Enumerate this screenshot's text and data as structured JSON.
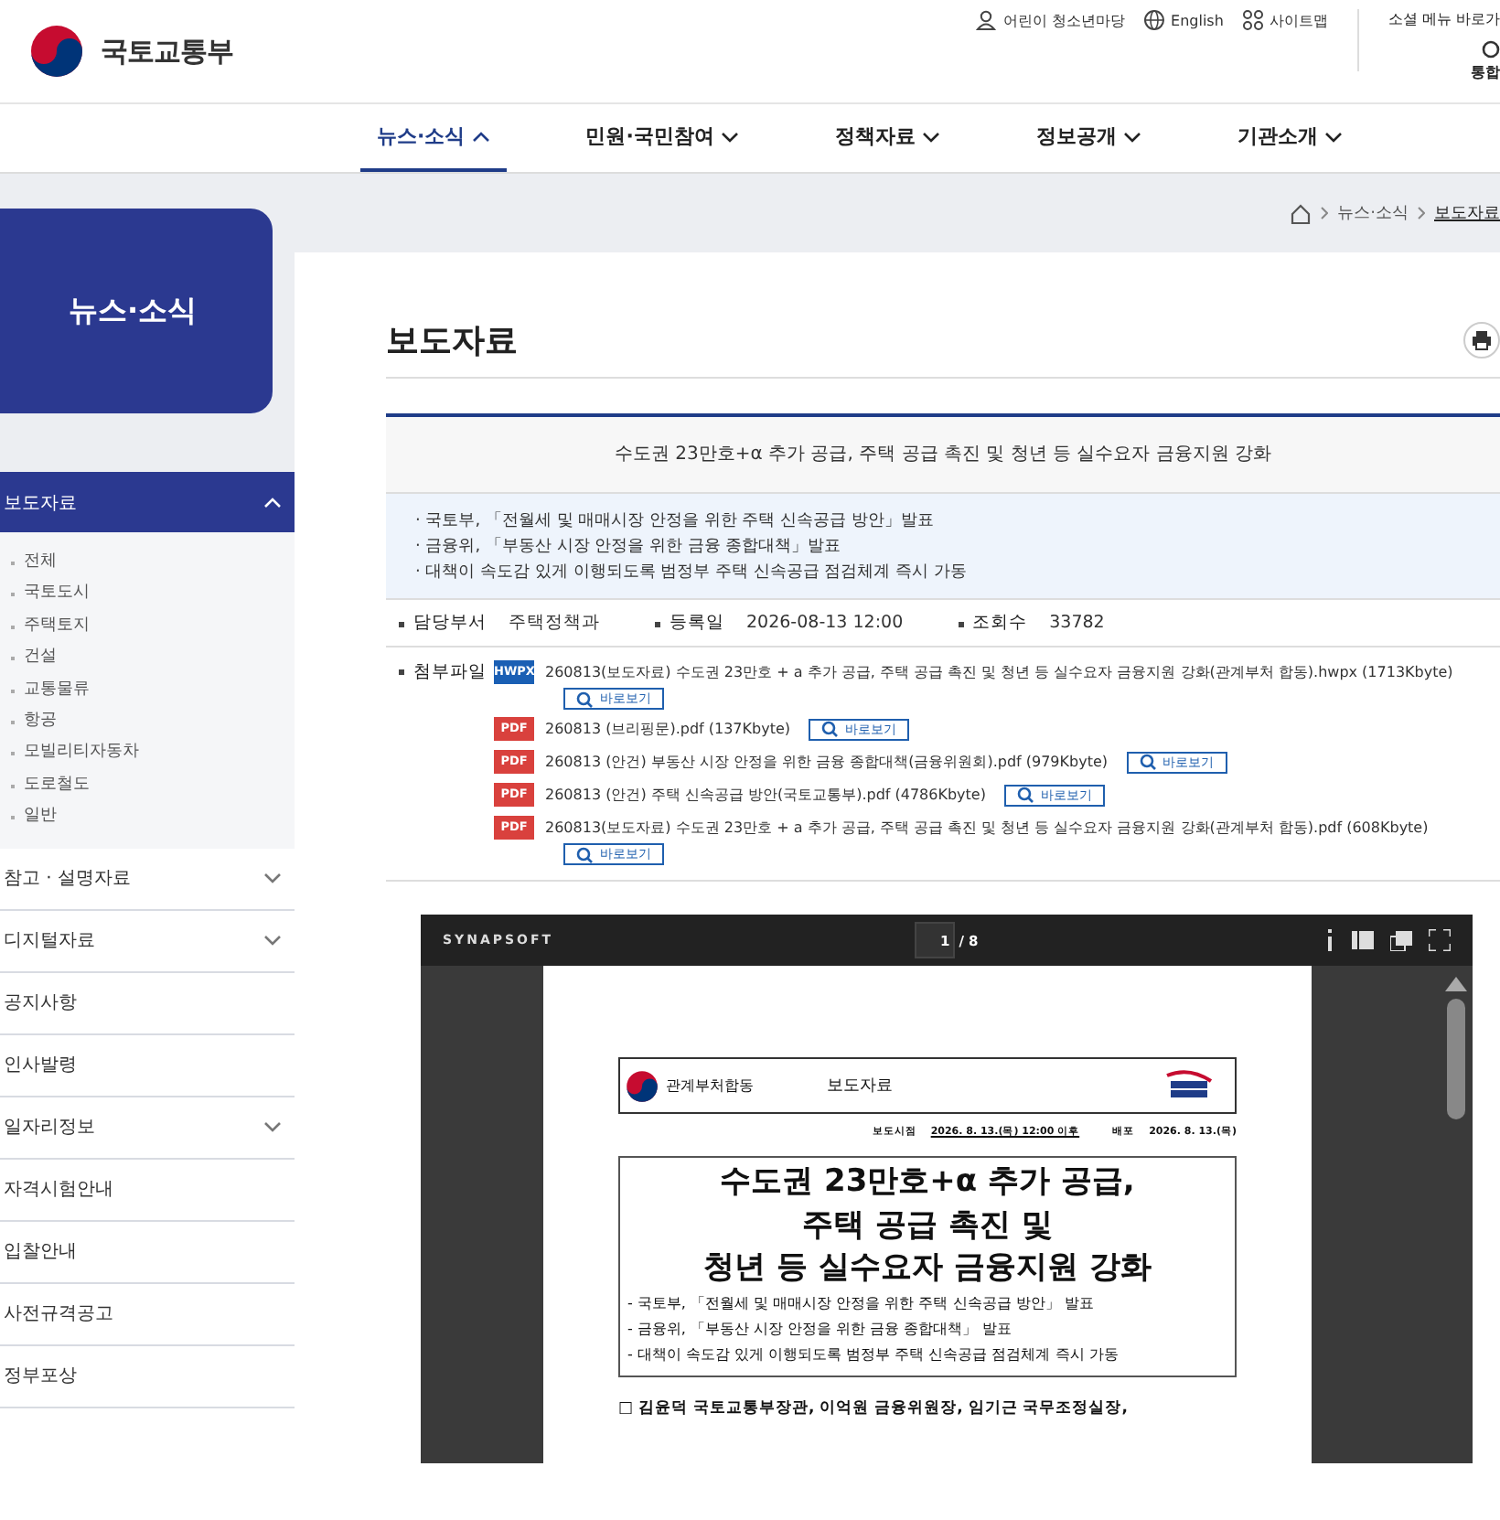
{
  "header": {
    "logo_text": "국토교통부",
    "utility_links": [
      {
        "label": "어린이 청소년마당"
      },
      {
        "label": "English"
      },
      {
        "label": "사이트맵"
      }
    ],
    "social_menu": "소셜 메뉴 바로가",
    "search_label": "통합"
  },
  "nav": [
    {
      "label": "뉴스·소식",
      "selected": true
    },
    {
      "label": "민원·국민참여",
      "selected": false
    },
    {
      "label": "정책자료",
      "selected": false
    },
    {
      "label": "정보공개",
      "selected": false
    },
    {
      "label": "기관소개",
      "selected": false
    }
  ],
  "sidebar": {
    "title": "뉴스·소식",
    "items": [
      {
        "label": "보도자료",
        "expandable": true,
        "expanded": true,
        "children": [
          {
            "label": "전체"
          },
          {
            "label": "국토도시"
          },
          {
            "label": "주택토지"
          },
          {
            "label": "건설"
          },
          {
            "label": "교통물류"
          },
          {
            "label": "항공"
          },
          {
            "label": "모빌리티자동차"
          },
          {
            "label": "도로철도"
          },
          {
            "label": "일반"
          }
        ]
      },
      {
        "label": "참고 · 설명자료",
        "expandable": true,
        "expanded": false
      },
      {
        "label": "디지털자료",
        "expandable": true,
        "expanded": false
      },
      {
        "label": "공지사항",
        "expandable": false,
        "expanded": false
      },
      {
        "label": "인사발령",
        "expandable": false,
        "expanded": false
      },
      {
        "label": "일자리정보",
        "expandable": true,
        "expanded": false
      },
      {
        "label": "자격시험안내",
        "expandable": false,
        "expanded": false
      },
      {
        "label": "입찰안내",
        "expandable": false,
        "expanded": false
      },
      {
        "label": "사전규격공고",
        "expandable": false,
        "expanded": false
      },
      {
        "label": "정부포상",
        "expandable": false,
        "expanded": false
      }
    ]
  },
  "breadcrumb": [
    "뉴스·소식",
    "보도자료"
  ],
  "page_title": "보도자료",
  "article": {
    "subject": "수도권 23만호+α 추가 공급, 주택 공급 촉진 및 청년 등 실수요자 금융지원 강화",
    "summary": [
      "· 국토부, 「전월세 및 매매시장 안정을 위한 주택 신속공급 방안」발표",
      "· 금융위, 「부동산 시장 안정을 위한 금융 종합대책」발표",
      "· 대책이 속도감 있게 이행되도록 범정부 주택 신속공급 점검체계 즉시 가동"
    ],
    "meta": [
      {
        "label": "담당부서",
        "value": "주택정책과"
      },
      {
        "label": "등록일",
        "value": "2026-08-13 12:00"
      },
      {
        "label": "조회수",
        "value": "33782"
      }
    ],
    "attachments_label": "첨부파일",
    "attachments": [
      {
        "kind": "hwpx",
        "badge": "HWPX",
        "name": "260813(보도자료) 수도권 23만호 + a 추가 공급, 주택 공급 촉진 및 청년 등 실수요자 금융지원 강화(관계부처 합동).hwpx",
        "size": "(1713Kbyte)",
        "button": "바로보기"
      },
      {
        "kind": "pdf",
        "badge": "PDF",
        "name": "260813 (브리핑문).pdf",
        "size": "(137Kbyte)",
        "button": "바로보기"
      },
      {
        "kind": "pdf",
        "badge": "PDF",
        "name": "260813 (안건) 부동산 시장 안정을 위한 금융 종합대책(금융위원회).pdf",
        "size": "(979Kbyte)",
        "button": "바로보기"
      },
      {
        "kind": "pdf",
        "badge": "PDF",
        "name": "260813 (안건) 주택 신속공급 방안(국토교통부).pdf",
        "size": "(4786Kbyte)",
        "button": "바로보기"
      },
      {
        "kind": "pdf",
        "badge": "PDF",
        "name": "260813(보도자료) 수도권 23만호 + a 추가 공급, 주택 공급 촉진 및 청년 등 실수요자 금융지원 강화(관계부처 합동).pdf",
        "size": "(608Kbyte)",
        "button": "바로보기"
      }
    ]
  },
  "viewer": {
    "brand": "SYNAPSOFT",
    "page_input": "1",
    "page_total": "/ 8",
    "document": {
      "header_left": "관계부처합동",
      "header_center": "보도자료",
      "release_label": "보도시점",
      "release_value": "2026. 8. 13.(목) 12:00 이후",
      "dist_label": "배포",
      "dist_value": "2026. 8. 13.(목)",
      "title_lines": [
        "수도권 23만호+α 추가 공급,",
        "주택 공급 촉진 및",
        "청년 등 실수요자 금융지원 강화"
      ],
      "bullets": [
        "- 국토부, 「전월세 및 매매시장 안정을 위한 주택 신속공급 방안」 발표",
        "- 금융위, 「부동산 시장 안정을 위한 금융 종합대책」 발표",
        "- 대책이 속도감 있게 이행되도록 범정부 주택 신속공급 점검체계 즉시 가동"
      ],
      "paragraph": "□ 김윤덕 국토교통부장관, 이억원 금융위원장, 임기근 국무조정실장,"
    }
  }
}
